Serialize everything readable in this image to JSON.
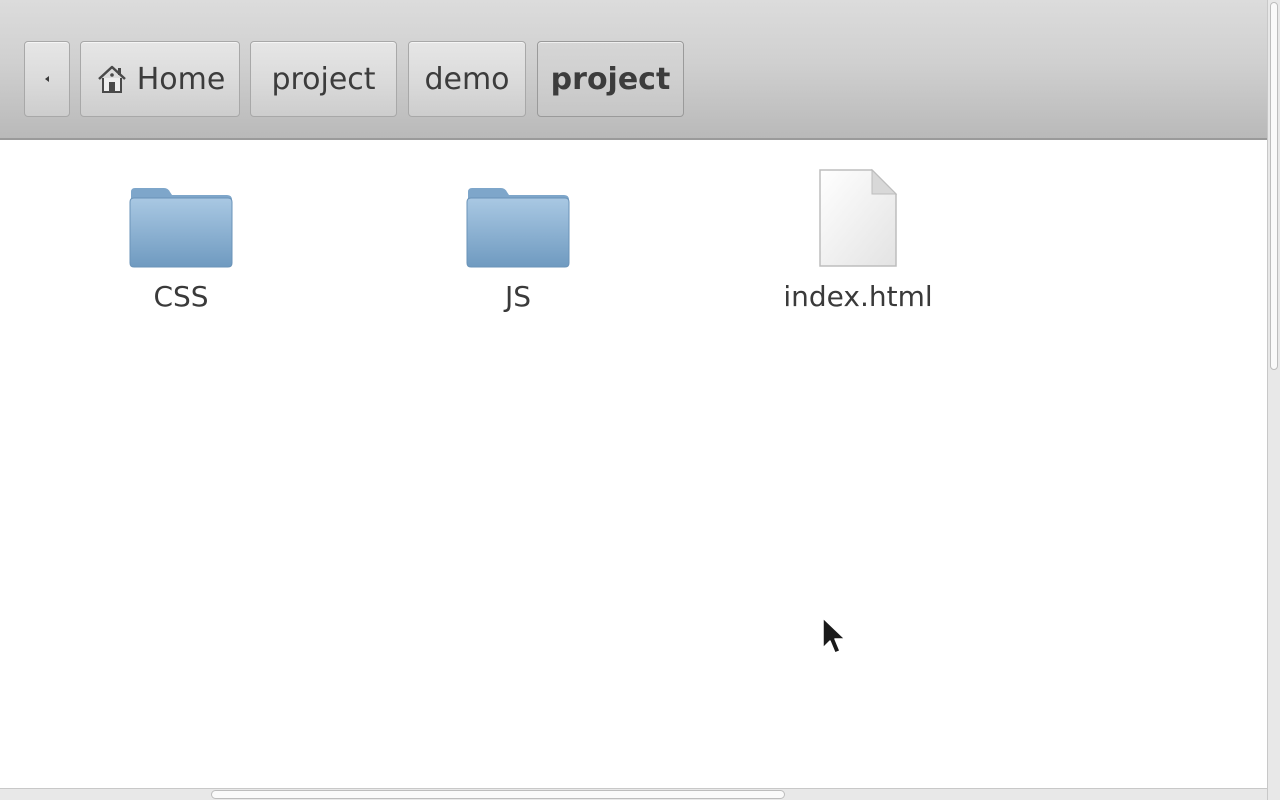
{
  "breadcrumb": {
    "back_icon": "left-arrow-icon",
    "home_icon": "home-icon",
    "items": [
      {
        "label": "Home"
      },
      {
        "label": "project"
      },
      {
        "label": "demo"
      },
      {
        "label": "project"
      }
    ]
  },
  "files": [
    {
      "name": "CSS",
      "type": "folder",
      "icon": "folder-icon"
    },
    {
      "name": "JS",
      "type": "folder",
      "icon": "folder-icon"
    },
    {
      "name": "index.html",
      "type": "file",
      "icon": "document-icon"
    }
  ],
  "colors": {
    "folder": "#7fa9cd",
    "toolbar": "#d0d0d0"
  }
}
